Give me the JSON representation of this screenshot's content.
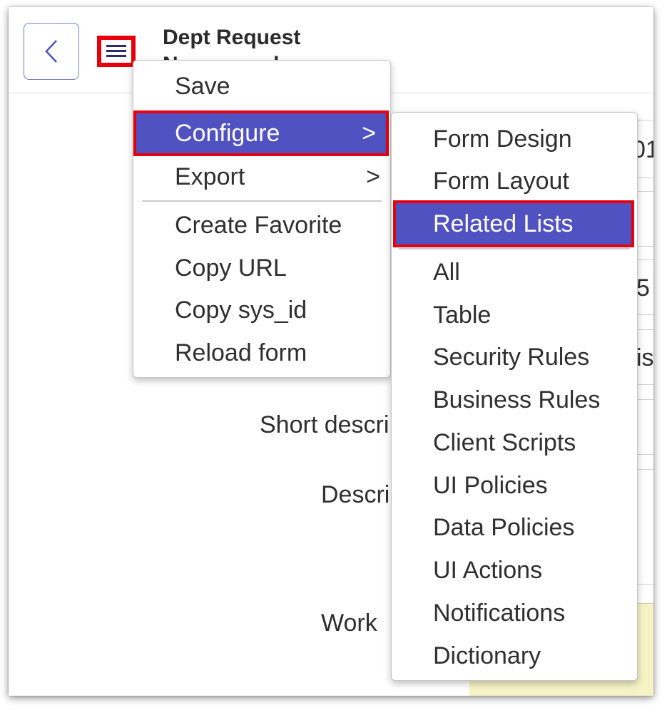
{
  "header": {
    "title": "Dept Request",
    "subtitle": "New record"
  },
  "form": {
    "short_description_label": "Short descri",
    "description_label": "Descri",
    "work_notes_label": "Work",
    "fragment_1": "01",
    "fragment_2": "5",
    "fragment_3": "is"
  },
  "context_menu": {
    "items": [
      {
        "label": "Save"
      },
      {
        "label": "Configure",
        "chevron": ">"
      },
      {
        "label": "Export",
        "chevron": ">"
      },
      {
        "label": "Create Favorite"
      },
      {
        "label": "Copy URL"
      },
      {
        "label": "Copy sys_id"
      },
      {
        "label": "Reload form"
      }
    ]
  },
  "configure_submenu": {
    "items": [
      {
        "label": "Form Design"
      },
      {
        "label": "Form Layout"
      },
      {
        "label": "Related Lists"
      },
      {
        "label": "All"
      },
      {
        "label": "Table"
      },
      {
        "label": "Security Rules"
      },
      {
        "label": "Business Rules"
      },
      {
        "label": "Client Scripts"
      },
      {
        "label": "UI Policies"
      },
      {
        "label": "Data Policies"
      },
      {
        "label": "UI Actions"
      },
      {
        "label": "Notifications"
      },
      {
        "label": "Dictionary"
      }
    ]
  },
  "colors": {
    "highlight": "#5152c1",
    "annotation_red": "#e8000a",
    "back_border": "#7b7fc4",
    "work_notes_bg": "#f6f4c7"
  },
  "icons": {
    "back": "chevron-left-icon",
    "menu": "hamburger-menu-icon"
  }
}
